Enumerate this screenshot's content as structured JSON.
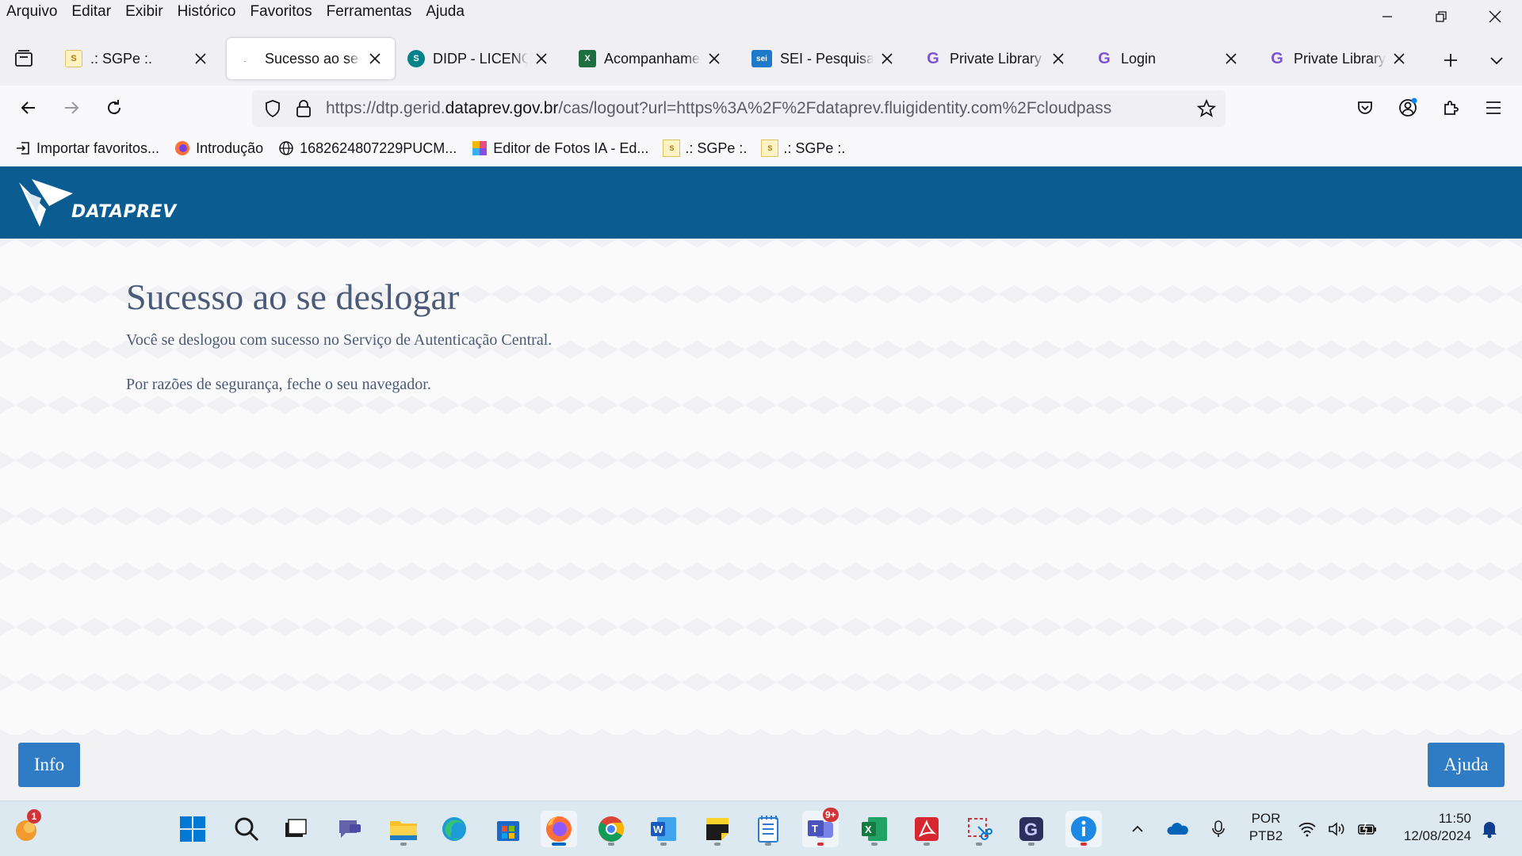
{
  "menubar": {
    "items": [
      "Arquivo",
      "Editar",
      "Exibir",
      "Histórico",
      "Favoritos",
      "Ferramentas",
      "Ajuda"
    ]
  },
  "tabs": [
    {
      "title": ".: SGPe :.",
      "icon": "sgpe-icon"
    },
    {
      "title": "Sucesso ao se deslogar",
      "icon": "loading-icon",
      "active": true
    },
    {
      "title": "DIDP - LICENÇA",
      "icon": "sharepoint-icon"
    },
    {
      "title": "Acompanhamento",
      "icon": "excel-icon"
    },
    {
      "title": "SEI - Pesquisa",
      "icon": "sei-icon"
    },
    {
      "title": "Private Library | G",
      "icon": "g-icon"
    },
    {
      "title": "Login",
      "icon": "g-icon"
    },
    {
      "title": "Private Library | G",
      "icon": "g-icon"
    }
  ],
  "urlbar": {
    "prefix": "https://dtp.gerid.",
    "host": "dataprev.gov.br",
    "suffix": "/cas/logout?url=https%3A%2F%2Fdataprev.fluigidentity.com%2Fcloudpass"
  },
  "bookmarks": [
    {
      "label": "Importar favoritos...",
      "icon": "import-icon"
    },
    {
      "label": "Introdução",
      "icon": "firefox-icon"
    },
    {
      "label": "1682624807229PUCM...",
      "icon": "globe-icon"
    },
    {
      "label": "Editor de Fotos IA - Ed...",
      "icon": "photo-editor-icon"
    },
    {
      "label": ".: SGPe :.",
      "icon": "sgpe-icon"
    },
    {
      "label": ".: SGPe :.",
      "icon": "sgpe-icon"
    }
  ],
  "page": {
    "logo_text": "DATAPREV",
    "title": "Sucesso ao se deslogar",
    "message1": "Você se deslogou com sucesso no Serviço de Autenticação Central.",
    "message2": "Por razões de segurança, feche o seu navegador.",
    "info_button": "Info",
    "help_button": "Ajuda"
  },
  "taskbar": {
    "notification_badge": "1",
    "teams_badge": "9+",
    "lang_line1": "POR",
    "lang_line2": "PTB2",
    "time": "11:50",
    "date": "12/08/2024"
  },
  "colors": {
    "header_blue": "#0b5c91",
    "button_blue": "#2f7cc4",
    "text_slate": "#4a5a78"
  }
}
